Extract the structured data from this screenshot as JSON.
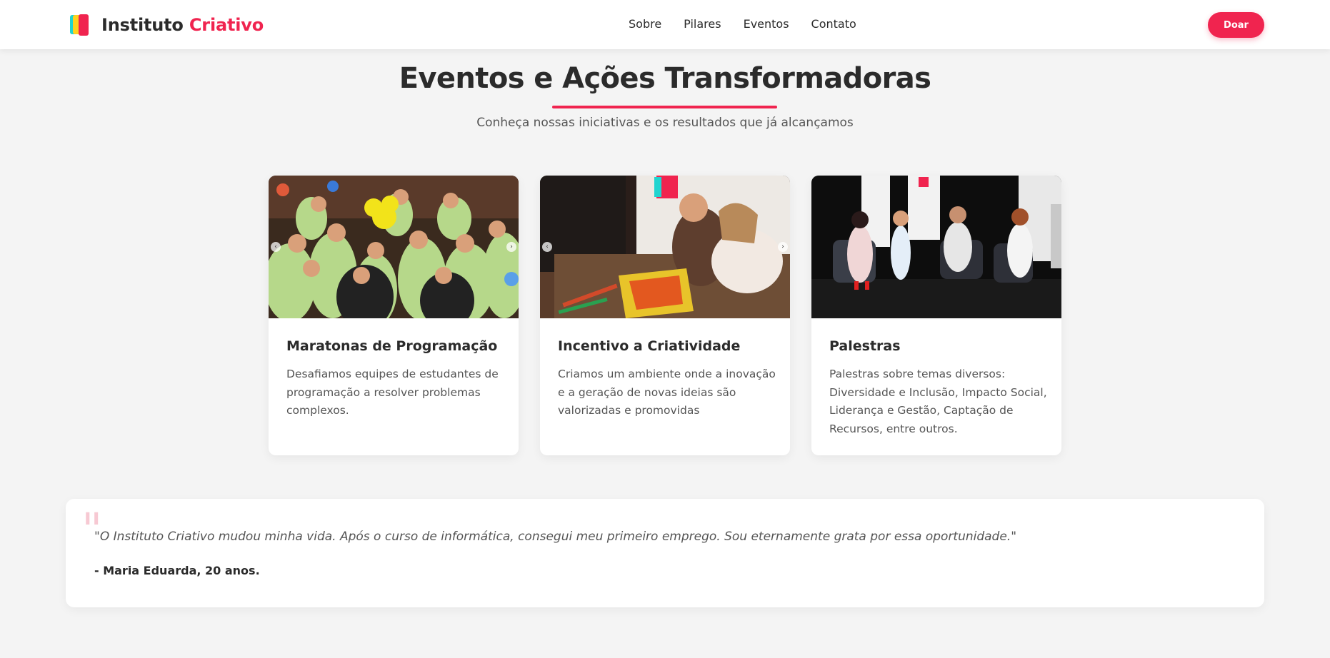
{
  "header": {
    "brand_main": "Instituto",
    "brand_accent": "Criativo",
    "nav": [
      "Sobre",
      "Pilares",
      "Eventos",
      "Contato"
    ],
    "donate_label": "Doar"
  },
  "section": {
    "title": "Eventos e Ações Transformadoras",
    "subtitle": "Conheça nossas iniciativas e os resultados que já alcançamos"
  },
  "cards": [
    {
      "title": "Maratonas de Programação",
      "text": "Desafiamos equipes de estudantes de programação a resolver problemas complexos.",
      "image": "group-photo-hackathon"
    },
    {
      "title": "Incentivo a Criatividade",
      "text": "Criamos um ambiente onde a inovação e a geração de novas ideias são valorizadas e promovidas",
      "image": "child-drawing-photo"
    },
    {
      "title": "Palestras",
      "text": "Palestras sobre temas diversos: Diversidade e Inclusão, Impacto Social, Liderança e Gestão, Captação de Recursos, entre outros.",
      "image": "panel-talk-photo"
    }
  ],
  "testimonial": {
    "quote": "\"O Instituto Criativo mudou minha vida. Após o curso de informática, consegui meu primeiro emprego. Sou eternamente grata por essa oportunidade.\"",
    "author": "- Maria Eduarda, 20 anos."
  },
  "colors": {
    "accent": "#f0244f",
    "background": "#f4f4f4",
    "logo_cyan": "#21d4d0",
    "logo_yellow": "#ffd21e"
  }
}
